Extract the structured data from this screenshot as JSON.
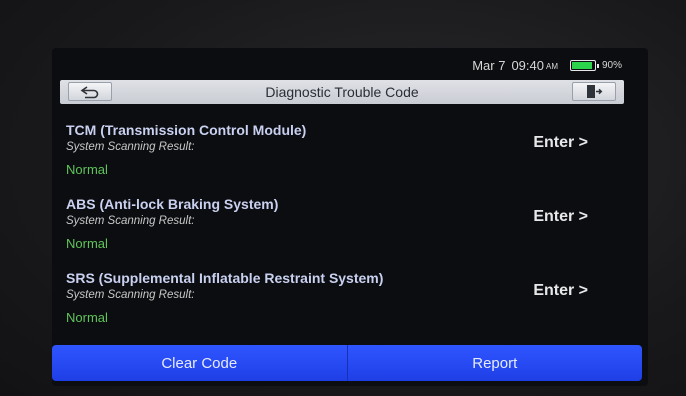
{
  "status_bar": {
    "date": "Mar 7",
    "time": "09:40",
    "ampm": "AM",
    "battery_percent": "90%",
    "battery_level": 0.9
  },
  "header": {
    "title": "Diagnostic Trouble Code",
    "back_icon": "back-arrow-icon",
    "exit_icon": "exit-door-icon"
  },
  "systems": [
    {
      "name": "TCM (Transmission Control Module)",
      "subtitle": "System Scanning Result:",
      "status": "Normal",
      "enter_label": "Enter >"
    },
    {
      "name": "ABS (Anti-lock Braking System)",
      "subtitle": "System Scanning Result:",
      "status": "Normal",
      "enter_label": "Enter >"
    },
    {
      "name": "SRS (Supplemental Inflatable Restraint System)",
      "subtitle": "System Scanning Result:",
      "status": "Normal",
      "enter_label": "Enter >"
    }
  ],
  "footer": {
    "clear_code_label": "Clear Code",
    "report_label": "Report"
  },
  "colors": {
    "accent_blue": "#2448f5",
    "status_green": "#5fc45a",
    "battery_green": "#2bd44a"
  }
}
